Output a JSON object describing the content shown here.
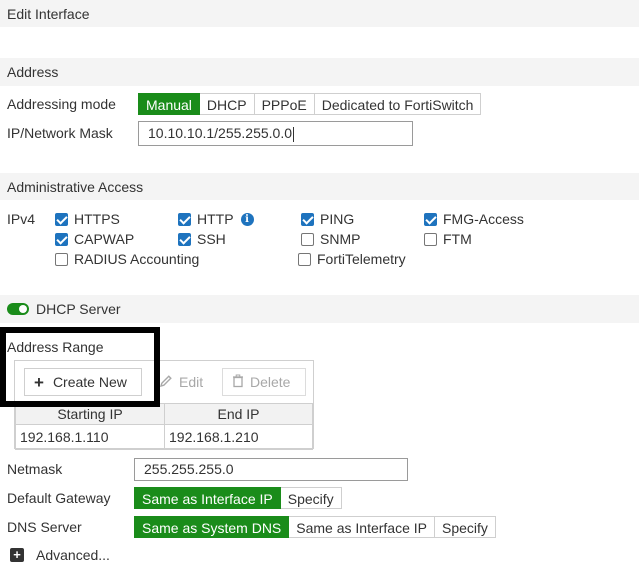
{
  "header": {
    "title": "Edit Interface"
  },
  "address": {
    "section_title": "Address",
    "mode_label": "Addressing mode",
    "modes": [
      "Manual",
      "DHCP",
      "PPPoE",
      "Dedicated to FortiSwitch"
    ],
    "selected_mode": "Manual",
    "ip_label": "IP/Network Mask",
    "ip_value": "10.10.10.1/255.255.0.0"
  },
  "admin_access": {
    "section_title": "Administrative Access",
    "ipv4_label": "IPv4",
    "options": [
      {
        "label": "HTTPS",
        "checked": true
      },
      {
        "label": "HTTP",
        "checked": true
      },
      {
        "label": "PING",
        "checked": true
      },
      {
        "label": "FMG-Access",
        "checked": true
      },
      {
        "label": "CAPWAP",
        "checked": true
      },
      {
        "label": "SSH",
        "checked": true
      },
      {
        "label": "SNMP",
        "checked": false
      },
      {
        "label": "FTM",
        "checked": false
      },
      {
        "label": "RADIUS Accounting",
        "checked": false
      },
      {
        "label": "FortiTelemetry",
        "checked": false
      }
    ]
  },
  "dhcp_server": {
    "toggle_label": "DHCP Server",
    "enabled": true,
    "address_range_label": "Address Range",
    "toolbar": {
      "create_new": "Create New",
      "edit": "Edit",
      "delete": "Delete"
    },
    "table": {
      "columns": [
        "Starting IP",
        "End IP"
      ],
      "rows": [
        [
          "192.168.1.110",
          "192.168.1.210"
        ]
      ]
    },
    "netmask_label": "Netmask",
    "netmask_value": "255.255.255.0",
    "gateway_label": "Default Gateway",
    "gateway_options": [
      "Same as Interface IP",
      "Specify"
    ],
    "gateway_selected": "Same as Interface IP",
    "dns_label": "DNS Server",
    "dns_options": [
      "Same as System DNS",
      "Same as Interface IP",
      "Specify"
    ],
    "dns_selected": "Same as System DNS",
    "advanced_label": "Advanced..."
  },
  "colors": {
    "accent_green": "#1a8c1a",
    "checkbox_blue": "#1e73be",
    "info_blue": "#1e73be",
    "highlight_box": "#000000"
  }
}
